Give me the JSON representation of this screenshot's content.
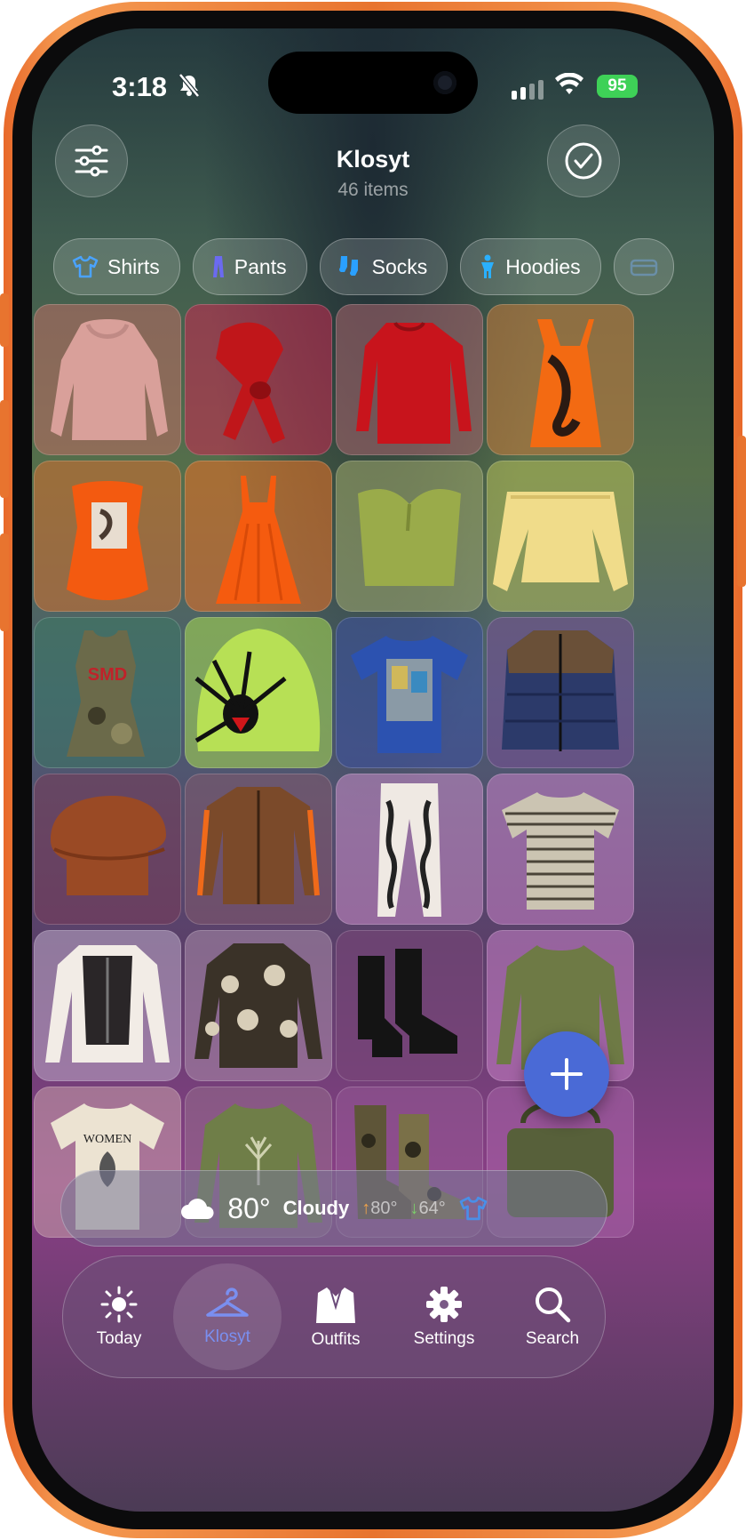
{
  "status_bar": {
    "time": "3:18",
    "battery": "95"
  },
  "header": {
    "title": "Klosyt",
    "subtitle": "46 items",
    "left_icon": "sliders-icon",
    "right_icon": "checkmark-circle-icon"
  },
  "categories": [
    {
      "label": "Shirts",
      "icon": "tshirt-icon"
    },
    {
      "label": "Pants",
      "icon": "pants-icon"
    },
    {
      "label": "Socks",
      "icon": "socks-icon"
    },
    {
      "label": "Hoodies",
      "icon": "person-icon"
    },
    {
      "label": "",
      "icon": "jacket-icon"
    }
  ],
  "items": [
    {
      "name": "pink cowl-neck blouse",
      "color": "#d9a09a"
    },
    {
      "name": "red silk scarf",
      "color": "#c0161a"
    },
    {
      "name": "red sweater",
      "color": "#c8141c"
    },
    {
      "name": "orange lace slip dress",
      "color": "#f36a12"
    },
    {
      "name": "orange corset top",
      "color": "#f35a10"
    },
    {
      "name": "orange maxi dress",
      "color": "#f55b0f"
    },
    {
      "name": "green tube top",
      "color": "#9aab4a"
    },
    {
      "name": "yellow off-shoulder blouse",
      "color": "#f0dc8a"
    },
    {
      "name": "camo tank dress",
      "color": "#6b6a4a"
    },
    {
      "name": "lime spider beanie",
      "color": "#b7e055"
    },
    {
      "name": "blue graphic tee",
      "color": "#2c52b0"
    },
    {
      "name": "navy puffer vest jacket",
      "color": "#2c3a6a"
    },
    {
      "name": "rust newsboy cap",
      "color": "#9a4a25"
    },
    {
      "name": "brown track jacket",
      "color": "#7b4a2a"
    },
    {
      "name": "white floral leggings",
      "color": "#efe9e3"
    },
    {
      "name": "striped tee",
      "color": "#a49a84"
    },
    {
      "name": "white lace corset top",
      "color": "#f2ece6"
    },
    {
      "name": "floral print shirt",
      "color": "#3a3228"
    },
    {
      "name": "black ankle boots",
      "color": "#141414"
    },
    {
      "name": "olive sweater",
      "color": "#6e7a45"
    },
    {
      "name": "women graphic tee",
      "color": "#ece3d2"
    },
    {
      "name": "olive floral sweatshirt",
      "color": "#6f7e48"
    },
    {
      "name": "camo boots",
      "color": "#5e5538"
    },
    {
      "name": "olive bag",
      "color": "#57603a"
    }
  ],
  "weather": {
    "temp": "80°",
    "condition": "Cloudy",
    "high": "80°",
    "low": "64°"
  },
  "tabbar": [
    {
      "label": "Today",
      "icon": "sun-icon"
    },
    {
      "label": "Klosyt",
      "icon": "hanger-icon"
    },
    {
      "label": "Outfits",
      "icon": "suit-icon"
    },
    {
      "label": "Settings",
      "icon": "gear-icon"
    },
    {
      "label": "Search",
      "icon": "magnifier-icon"
    }
  ],
  "colors": {
    "accent": "#4a6ad6",
    "frame": "#e8742f",
    "battery": "#3ed157"
  }
}
